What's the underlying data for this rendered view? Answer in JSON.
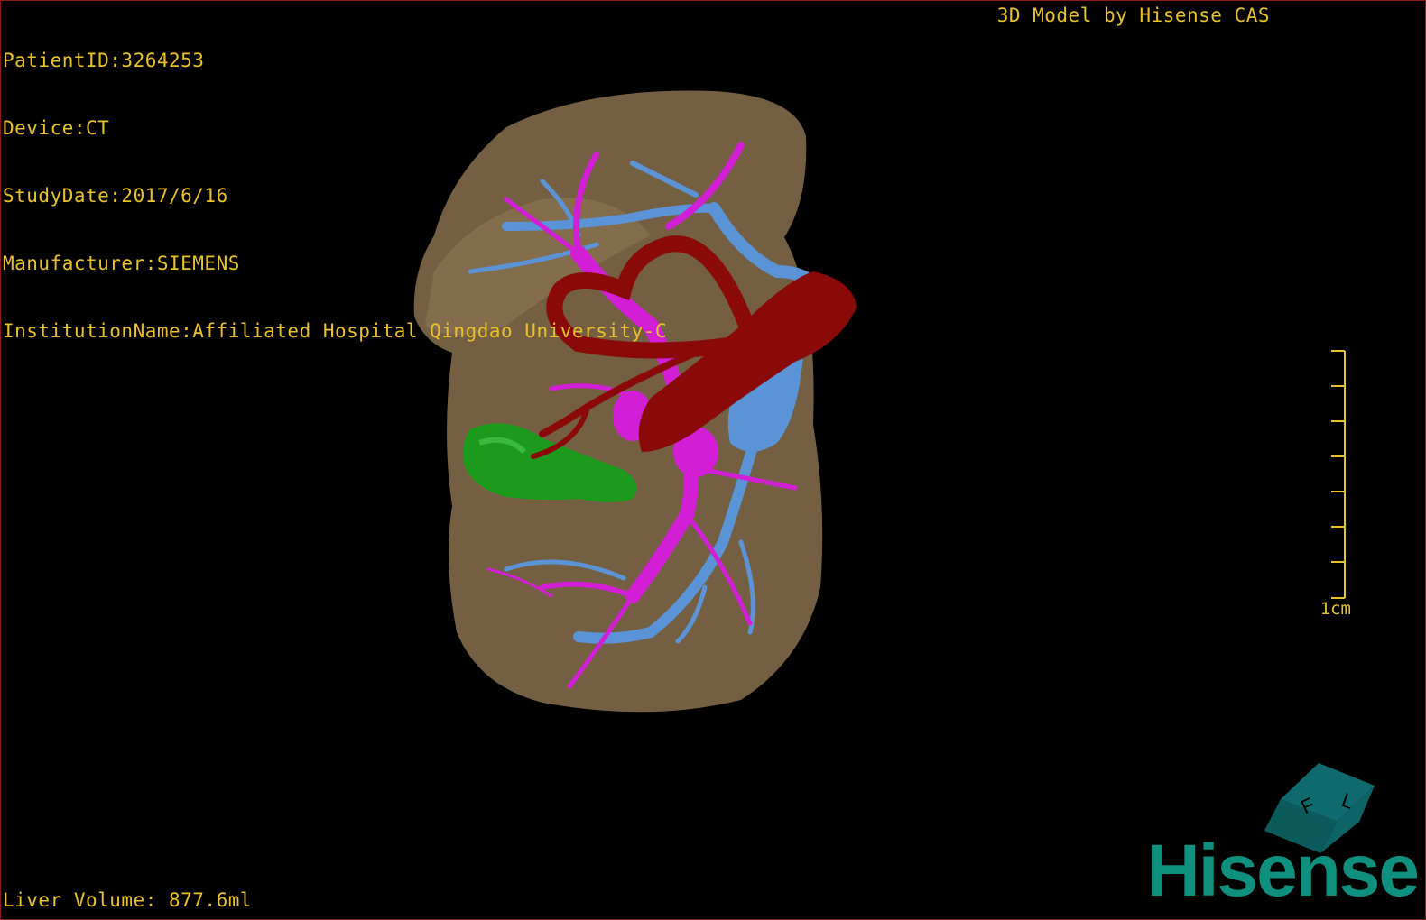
{
  "patient_info": {
    "patient_id": "PatientID:3264253",
    "device": "Device:CT",
    "study_date": "StudyDate:2017/6/16",
    "manufacturer": "Manufacturer:SIEMENS",
    "institution": "InstitutionName:Affiliated Hospital Qingdao University-C"
  },
  "title": "3D Model by Hisense CAS",
  "liver_volume": "Liver Volume: 877.6ml",
  "scale_bar": {
    "label": "1cm"
  },
  "orientation_cube": {
    "face_letters": [
      "F",
      "L"
    ]
  },
  "logo": {
    "text": "Hisense"
  },
  "colors": {
    "overlay_text": "#e8c22a",
    "liver": "#7a6446",
    "portal_vein": "#d21fd6",
    "hepatic_vein": "#5a93d6",
    "artery": "#8a0a0a",
    "gallbladder": "#1c9a1c",
    "logo": "#0f8f7e"
  }
}
